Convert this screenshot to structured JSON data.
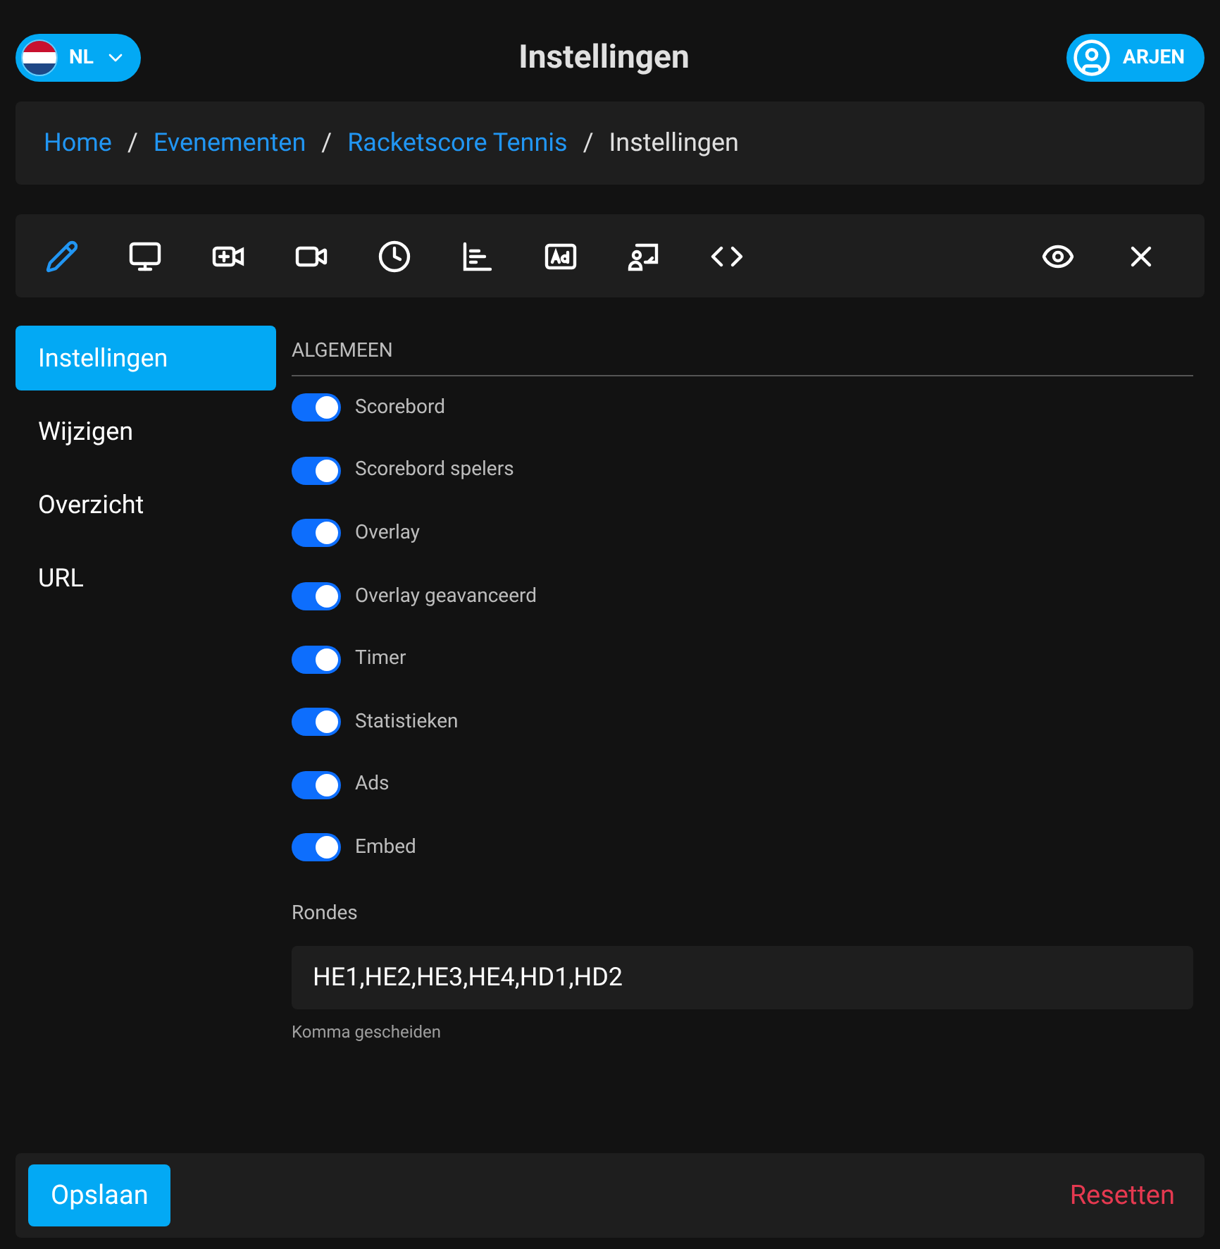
{
  "header": {
    "language": {
      "code": "NL"
    },
    "title": "Instellingen",
    "user": {
      "name": "ARJEN"
    }
  },
  "breadcrumb": [
    {
      "label": "Home",
      "link": true
    },
    {
      "separator": "/",
      "label": "Evenementen",
      "link": true
    },
    {
      "separator": "/",
      "label": "Racketscore Tennis",
      "link": true
    },
    {
      "separator": "/",
      "label": "Instellingen",
      "link": false
    }
  ],
  "toolbar": [
    {
      "kind": "pencil",
      "selected": true
    },
    {
      "kind": "monitor",
      "selected": false
    },
    {
      "kind": "video-plus",
      "selected": false
    },
    {
      "kind": "video",
      "selected": false
    },
    {
      "kind": "clock",
      "selected": false
    },
    {
      "kind": "chart",
      "selected": false
    },
    {
      "kind": "ad",
      "selected": false
    },
    {
      "kind": "presenter",
      "selected": false
    },
    {
      "kind": "code",
      "selected": false
    }
  ],
  "toolbar_right": [
    {
      "kind": "eye"
    },
    {
      "kind": "close"
    }
  ],
  "sidebar": {
    "items": [
      {
        "label": "Instellingen",
        "selected": true
      },
      {
        "label": "Wijzigen",
        "selected": false
      },
      {
        "label": "Overzicht",
        "selected": false
      },
      {
        "label": "URL",
        "selected": false
      }
    ]
  },
  "section": {
    "title": "ALGEMEEN",
    "toggles": [
      {
        "label": "Scorebord",
        "on": true
      },
      {
        "label": "Scorebord spelers",
        "on": true
      },
      {
        "label": "Overlay",
        "on": true
      },
      {
        "label": "Overlay geavanceerd",
        "on": true
      },
      {
        "label": "Timer",
        "on": true
      },
      {
        "label": "Statistieken",
        "on": true
      },
      {
        "label": "Ads",
        "on": true
      },
      {
        "label": "Embed",
        "on": true
      }
    ]
  },
  "rondes": {
    "label": "Rondes",
    "value": "HE1,HE2,HE3,HE4,HD1,HD2",
    "hint": "Komma gescheiden"
  },
  "footer": {
    "save": "Opslaan",
    "reset": "Resetten"
  }
}
